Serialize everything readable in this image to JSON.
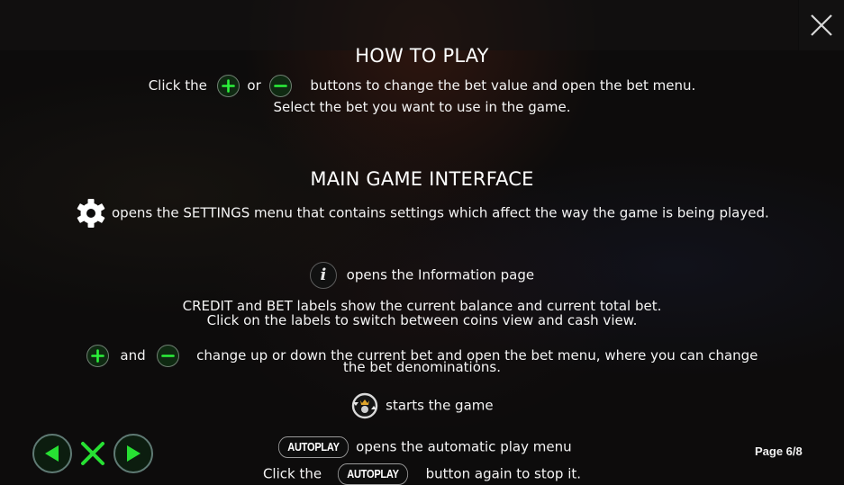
{
  "close_button": {
    "icon": "close-icon"
  },
  "how_to_play": {
    "title": "HOW TO PLAY",
    "line1_prefix": "Click the",
    "line1_or": "or",
    "line1_suffix": "buttons to change the bet value and open the bet menu.",
    "line2": "Select the bet you want to use in the game.",
    "plus_icon": "plus-icon",
    "minus_icon": "minus-icon"
  },
  "main_interface": {
    "title": "MAIN GAME INTERFACE",
    "settings_text": "opens the SETTINGS menu that contains settings which affect the way the game is being played.",
    "info_text": "opens the Information page",
    "info_glyph": "i",
    "credit_line1": "CREDIT and BET labels show the current balance and current total bet.",
    "credit_line2": "Click on the labels to switch between coins view and cash view.",
    "bet_and": "and",
    "bet_line1": "change up or down the current bet and open the bet menu, where you can change",
    "bet_line2": "the bet denominations.",
    "spin_text": "starts the game",
    "autoplay_label": "AUTOPLAY",
    "autoplay_text": "opens the automatic play menu",
    "autoplay_stop_prefix": "Click the",
    "autoplay_stop_suffix": "button again to stop it."
  },
  "navigation": {
    "prev_icon": "triangle-left-icon",
    "close_icon": "close-icon",
    "next_icon": "triangle-right-icon"
  },
  "page_indicator": "Page 6/8",
  "colors": {
    "accent_green": "#22e62e",
    "background": "#0d0c0c",
    "text": "#f4f4f4"
  }
}
